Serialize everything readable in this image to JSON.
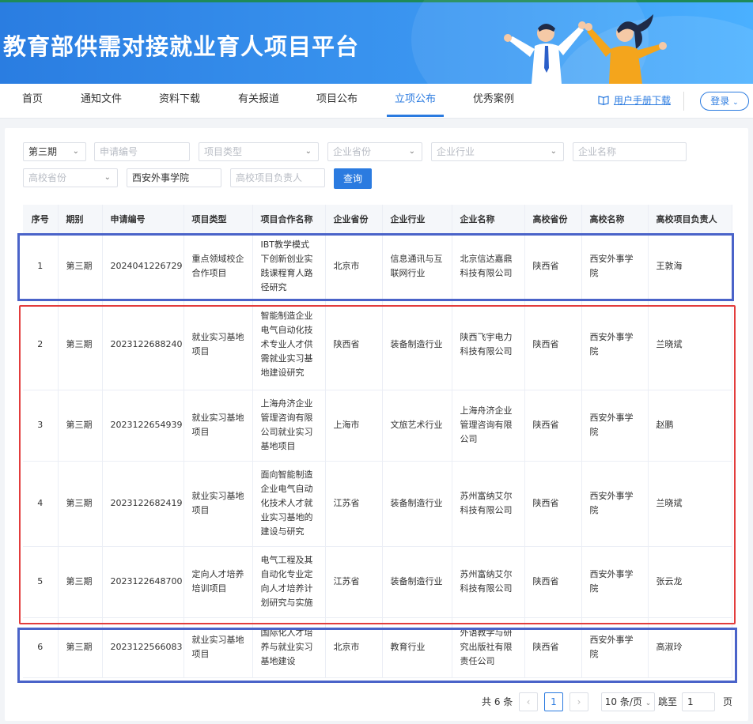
{
  "site": {
    "title": "教育部供需对接就业育人项目平台"
  },
  "nav": {
    "items": [
      "首页",
      "通知文件",
      "资料下载",
      "有关报道",
      "项目公布",
      "立项公布",
      "优秀案例"
    ],
    "active": "立项公布",
    "manual_label": "用户手册下载",
    "login_label": "登录"
  },
  "filters": {
    "period": "第三期",
    "application_no_ph": "申请编号",
    "project_type_ph": "项目类型",
    "company_province_ph": "企业省份",
    "company_industry_ph": "企业行业",
    "company_name_ph": "企业名称",
    "school_province_ph": "高校省份",
    "school_name": "西安外事学院",
    "school_leader_ph": "高校项目负责人",
    "query_label": "查询"
  },
  "table": {
    "columns": [
      "序号",
      "期别",
      "申请编号",
      "项目类型",
      "项目合作名称",
      "企业省份",
      "企业行业",
      "企业名称",
      "高校省份",
      "高校名称",
      "高校项目负责人"
    ],
    "rows": [
      [
        "1",
        "第三期",
        "2024041226729",
        "重点领域校企合作项目",
        "IBT教学模式下创新创业实践课程育人路径研究",
        "北京市",
        "信息通讯与互联网行业",
        "北京信达嘉鼎科技有限公司",
        "陕西省",
        "西安外事学院",
        "王敦海"
      ],
      [
        "2",
        "第三期",
        "2023122688240",
        "就业实习基地项目",
        "智能制造企业电气自动化技术专业人才供需就业实习基地建设研究",
        "陕西省",
        "装备制造行业",
        "陕西飞宇电力科技有限公司",
        "陕西省",
        "西安外事学院",
        "兰晓斌"
      ],
      [
        "3",
        "第三期",
        "2023122654939",
        "就业实习基地项目",
        "上海舟济企业管理咨询有限公司就业实习基地项目",
        "上海市",
        "文旅艺术行业",
        "上海舟济企业管理咨询有限公司",
        "陕西省",
        "西安外事学院",
        "赵鹏"
      ],
      [
        "4",
        "第三期",
        "2023122682419",
        "就业实习基地项目",
        "面向智能制造企业电气自动化技术人才就业实习基地的建设与研究",
        "江苏省",
        "装备制造行业",
        "苏州富纳艾尔科技有限公司",
        "陕西省",
        "西安外事学院",
        "兰晓斌"
      ],
      [
        "5",
        "第三期",
        "2023122648700",
        "定向人才培养培训项目",
        "电气工程及其自动化专业定向人才培养计划研究与实施",
        "江苏省",
        "装备制造行业",
        "苏州富纳艾尔科技有限公司",
        "陕西省",
        "西安外事学院",
        "张云龙"
      ],
      [
        "6",
        "第三期",
        "2023122566083",
        "就业实习基地项目",
        "国际化人才培养与就业实习基地建设",
        "北京市",
        "教育行业",
        "外语教学与研究出版社有限责任公司",
        "陕西省",
        "西安外事学院",
        "高淑玲"
      ]
    ]
  },
  "pagination": {
    "total_text": "共 6 条",
    "current_page": "1",
    "page_size": "10 条/页",
    "jump_label": "跳至",
    "jump_value": "1",
    "page_unit": "页",
    "prev_icon": "chevron-left-icon",
    "next_icon": "chevron-right-icon"
  },
  "colors": {
    "primary": "#2b7be0",
    "highlight_blue": "#4a63c9",
    "highlight_red": "#e23c3c"
  }
}
